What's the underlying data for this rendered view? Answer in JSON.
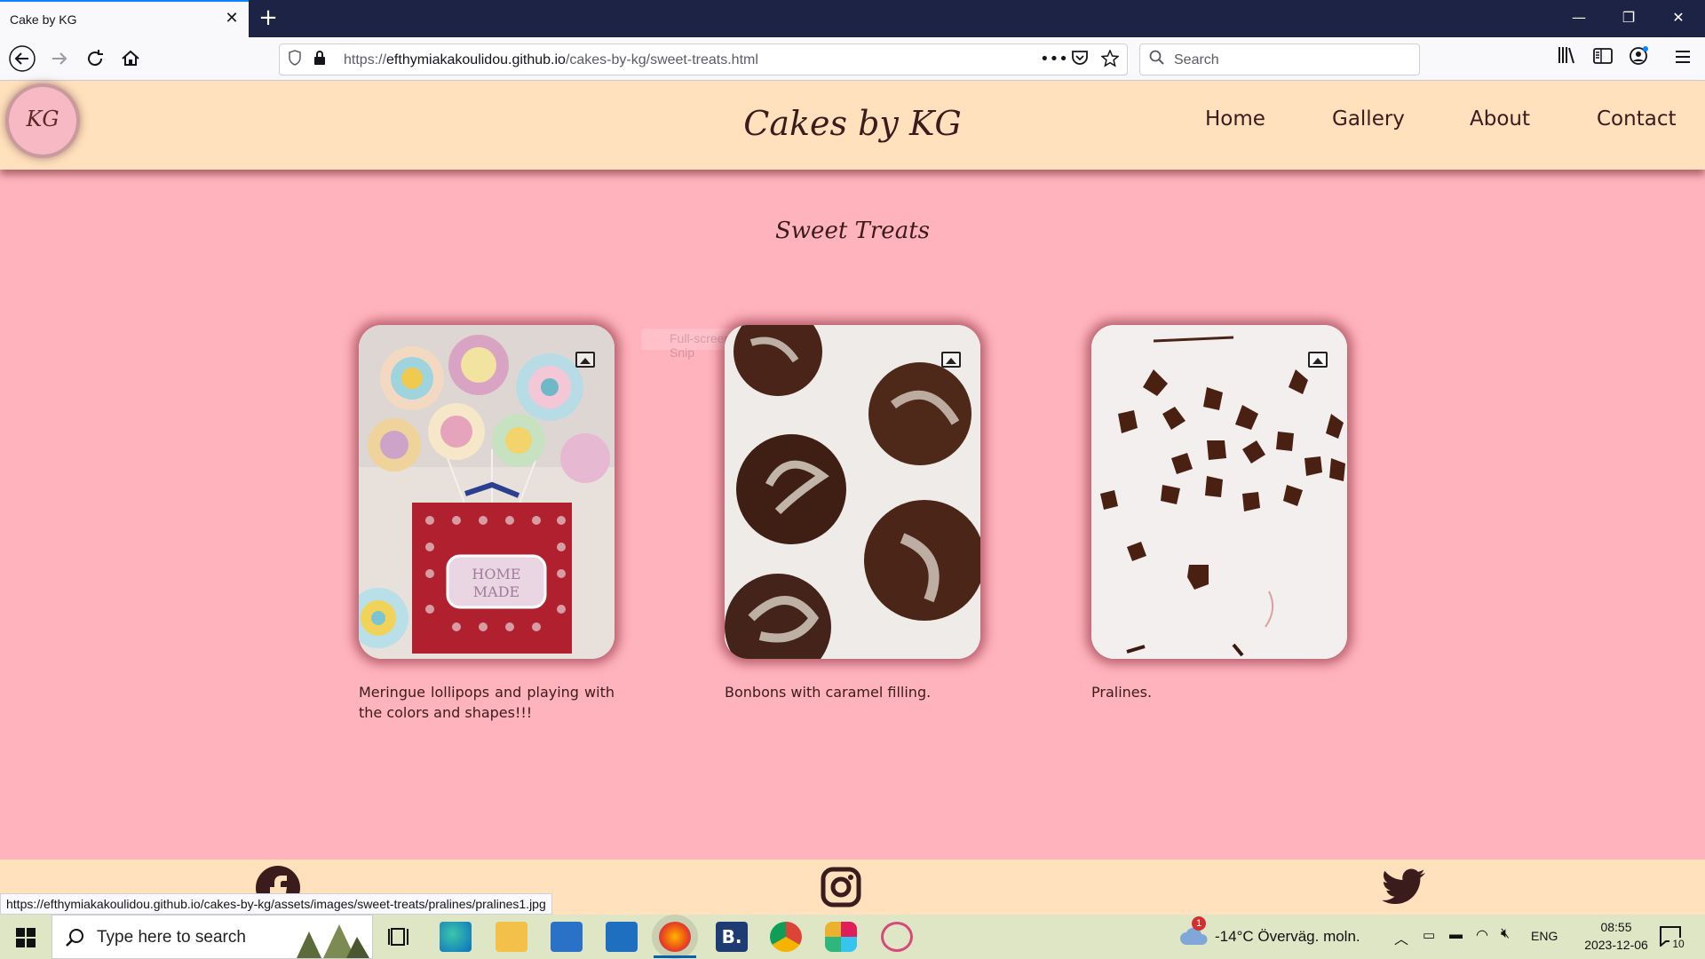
{
  "browser": {
    "tab_title": "Cake by KG",
    "url_scheme": "https://",
    "url_host": "efthymiakakoulidou.github.io",
    "url_path": "/cakes-by-kg/sweet-treats.html",
    "search_placeholder": "Search",
    "status_url": "https://efthymiakakoulidou.github.io/cakes-by-kg/assets/images/sweet-treats/pralines/pralines1.jpg"
  },
  "site": {
    "logo_text": "KG",
    "title": "Cakes by KG",
    "nav": [
      "Home",
      "Gallery",
      "About",
      "Contact"
    ]
  },
  "main": {
    "section_title": "Sweet Treats",
    "tooltip": "Full-screen Snip",
    "cards": [
      {
        "caption": "Meringue lollipops and playing with the colors and shapes!!!",
        "image": "meringue-lollipops"
      },
      {
        "caption": "Bonbons with caramel filling.",
        "image": "bonbons"
      },
      {
        "caption": "Pralines.",
        "image": "pralines"
      }
    ]
  },
  "footer": {
    "icons": [
      "facebook-icon",
      "instagram-icon",
      "twitter-icon"
    ]
  },
  "taskbar": {
    "search_placeholder": "Type here to search",
    "weather": "-14°C  Överväg. moln.",
    "weather_badge": "1",
    "language": "ENG",
    "time": "08:55",
    "date": "2023-12-06",
    "notifications": "10"
  },
  "colors": {
    "page_bg": "#ffb3bd",
    "header_bg": "#ffe1bd",
    "text": "#3a1c1c"
  }
}
